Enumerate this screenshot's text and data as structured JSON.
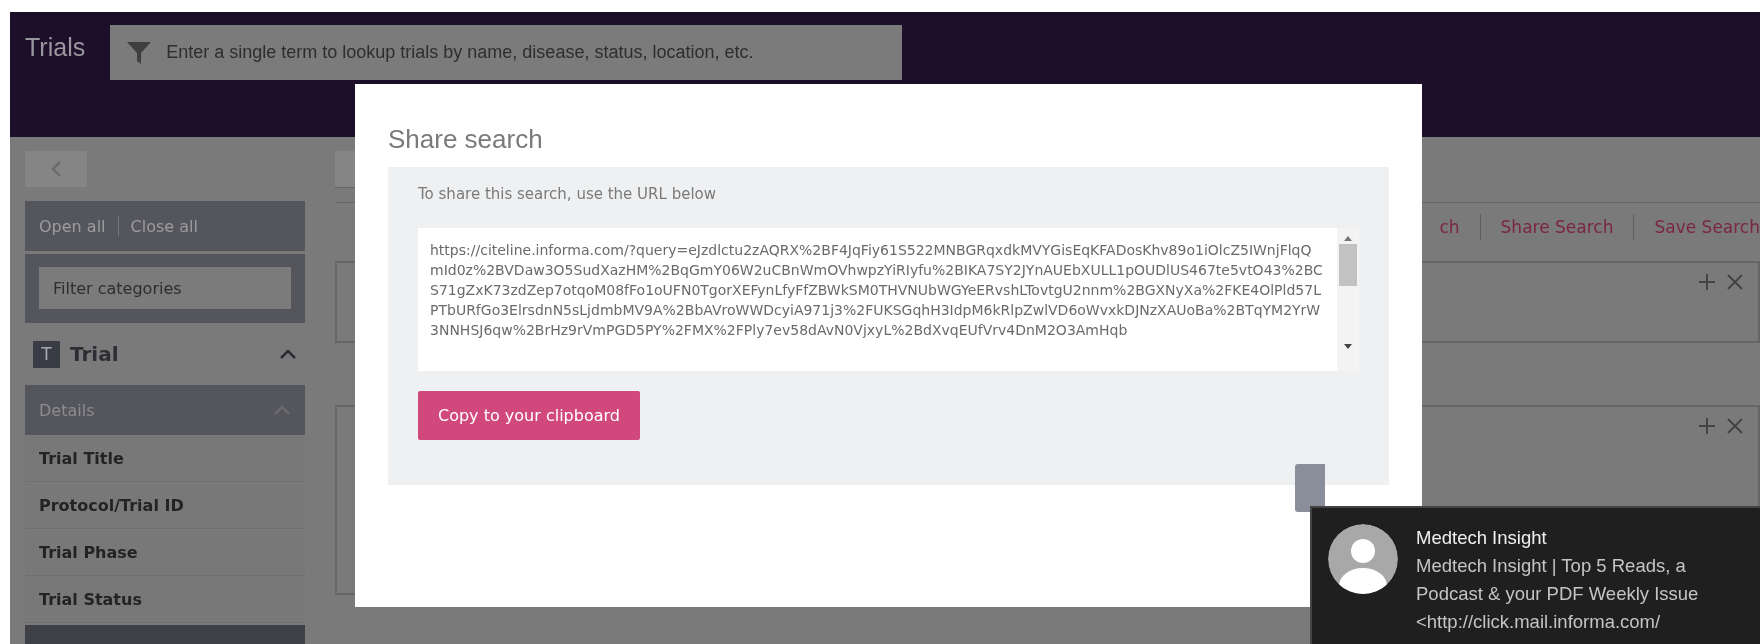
{
  "header": {
    "title": "Trials",
    "search": {
      "placeholder": "Enter a single term to lookup trials by name, disease, status, location, etc."
    }
  },
  "sidebar": {
    "links": [
      "Open all",
      "Close all"
    ],
    "filter": {
      "placeholder": "Filter categories"
    },
    "section": {
      "badge": "T",
      "title": "Trial",
      "expanded": true
    },
    "group": {
      "title": "Details",
      "expanded": true
    },
    "items": [
      "Trial Title",
      "Protocol/Trial ID",
      "Trial Phase",
      "Trial Status"
    ]
  },
  "toolbar": [
    "ch",
    "Share Search",
    "Save Search"
  ],
  "modal": {
    "title": "Share search",
    "instruction": "To share this search, use the URL below",
    "url": "https://citeline.informa.com/?query=eJzdlctu2zAQRX%2BF4JqFiy61S522MNBGRqxdkMVYGisEqKFADosKhv89o1iOlcZ5IWnjFlqQmId0z%2BVDaw3O5SudXazHM%2BqGmY06W2uCBnWmOVhwpzYiRIyfu%2BIKA7SY2JYnAUEbXULL1pOUDlUS467te5vtO43%2BCS71gZxK73zdZep7otqoM08fFo1oUFN0TgorXEFynLfyFfZBWkSM0THVNUbWGYeERvshLTovtgU2nnm%2BGXNyXa%2FKE4OlPld57LPTbURfGo3ElrsdnN5sLjdmbMV9A%2BbAVroWWDcyiA971j3%2FUKSGqhH3IdpM6kRlpZwlVD6oWvxkDJNzXAUoBa%2BTqYM2YrW3NNHSJ6qw%2BrHz9rVmPGD5PY%2FMX%2FPly7ev58dAvN0VjxyL%2BdXvqEUfVrv4DnM2O3AmHqb",
    "copy_button": "Copy to your clipboard"
  },
  "notification": {
    "title": "Medtech Insight",
    "lines": [
      "Medtech Insight | Top 5 Reads, a",
      "Podcast & your PDF Weekly Issue",
      "<http://click.mail.informa.com/"
    ]
  }
}
